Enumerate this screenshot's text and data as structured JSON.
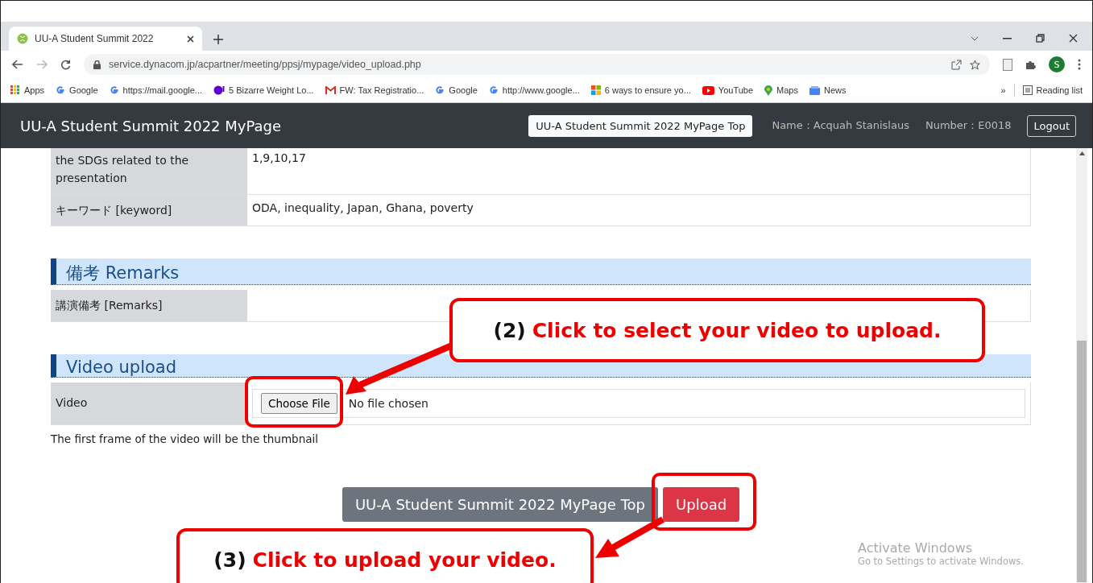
{
  "browser": {
    "tabs": [
      {
        "title": "UU-A Student Summit 2022",
        "selected": true
      }
    ],
    "url": "service.dynacom.jp/acpartner/meeting/ppsj/mypage/video_upload.php",
    "profile_initial": "S",
    "bookmarks": [
      {
        "label": "Apps",
        "kind": "apps"
      },
      {
        "label": "Google",
        "kind": "google"
      },
      {
        "label": "https://mail.google...",
        "kind": "google"
      },
      {
        "label": "5 Bizarre Weight Lo...",
        "kind": "yahoo"
      },
      {
        "label": "FW: Tax Registratio...",
        "kind": "gmail"
      },
      {
        "label": "Google",
        "kind": "google"
      },
      {
        "label": "http://www.google...",
        "kind": "google"
      },
      {
        "label": "6 ways to ensure yo...",
        "kind": "windows"
      },
      {
        "label": "YouTube",
        "kind": "youtube"
      },
      {
        "label": "Maps",
        "kind": "maps"
      },
      {
        "label": "News",
        "kind": "news"
      }
    ],
    "overflow": "»",
    "reading_list": "Reading list"
  },
  "site_header": {
    "title": "UU-A Student Summit 2022 MyPage",
    "top_button": "UU-A Student Summit 2022 MyPage Top",
    "name": "Name：Acquah Stanislaus",
    "number": "Number：E0018",
    "logout": "Logout"
  },
  "details": [
    {
      "label": "the SDGs related to the presentation",
      "value": "1,9,10,17"
    },
    {
      "label": "キーワード [keyword]",
      "value": "ODA, inequality, Japan, Ghana, poverty"
    }
  ],
  "remarks": {
    "heading": "備考 Remarks",
    "rows": [
      {
        "label": "講演備考 [Remarks]"
      }
    ]
  },
  "video_upload": {
    "heading": "Video upload",
    "label": "Video",
    "button": "Choose File",
    "status": "No file chosen",
    "note": "The first frame of the video will be the thumbnail"
  },
  "actions": [
    {
      "label": "UU-A Student Summit 2022 MyPage Top",
      "kind": "secondary"
    },
    {
      "label": "Upload",
      "kind": "primary"
    }
  ],
  "annotations": [
    {
      "step": "(2)",
      "text": "Click to select your video to upload."
    },
    {
      "step": "(3)",
      "text": "Click to upload your video."
    }
  ],
  "os_notice": {
    "title": "Activate Windows",
    "subtitle": "Go to Settings to activate Windows."
  }
}
